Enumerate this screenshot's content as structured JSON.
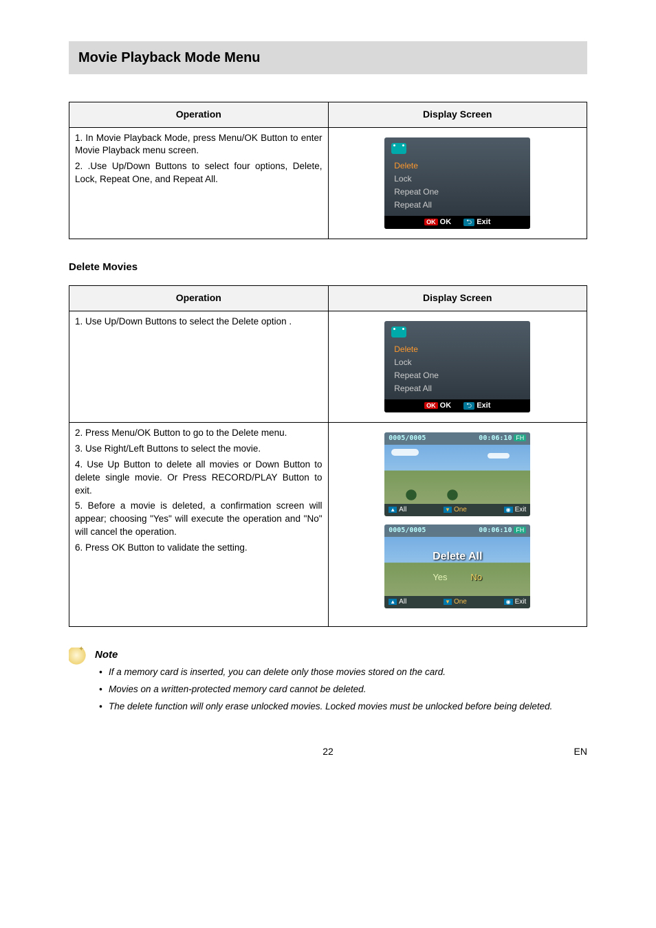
{
  "header": {
    "title": "Movie Playback Mode Menu"
  },
  "tables": {
    "headers": {
      "operation": "Operation",
      "display": "Display Screen"
    },
    "intro": {
      "steps": [
        "1. In Movie Playback Mode, press Menu/OK Button to enter Movie Playback menu screen.",
        "2. .Use Up/Down Buttons to select four options, Delete, Lock, Repeat One, and Repeat All."
      ]
    },
    "delete": {
      "title": "Delete Movies",
      "row1": {
        "step": "1. Use Up/Down Buttons to select the Delete option ."
      },
      "row2": {
        "steps": [
          "2. Press Menu/OK Button to go to the Delete menu.",
          "3. Use Right/Left Buttons to select the movie.",
          "4. Use Up Button to delete all movies or Down Button to delete single movie. Or Press RECORD/PLAY Button to exit.",
          "5. Before a movie is deleted, a confirmation screen will appear; choosing \"Yes\" will execute the operation and \"No\" will cancel the operation.",
          "6. Press OK Button to validate the setting."
        ]
      }
    }
  },
  "screens": {
    "menu": {
      "items": [
        "Delete",
        "Lock",
        "Repeat One",
        "Repeat All"
      ],
      "selected": "Delete",
      "ok": "OK",
      "exit": "Exit"
    },
    "playback": {
      "counter": "0005/0005",
      "time": "00:06:10",
      "fh": "FH",
      "all": "All",
      "one": "One",
      "exit": "Exit"
    },
    "confirm": {
      "title": "Delete All",
      "yes": "Yes",
      "no": "No"
    }
  },
  "note": {
    "title": "Note",
    "items": [
      "If a memory card is inserted, you can delete only those movies stored on the card.",
      "Movies on a written-protected memory card cannot be deleted.",
      "The delete function will only erase unlocked movies. Locked movies must be unlocked before being deleted."
    ]
  },
  "footer": {
    "page": "22",
    "lang": "EN"
  }
}
